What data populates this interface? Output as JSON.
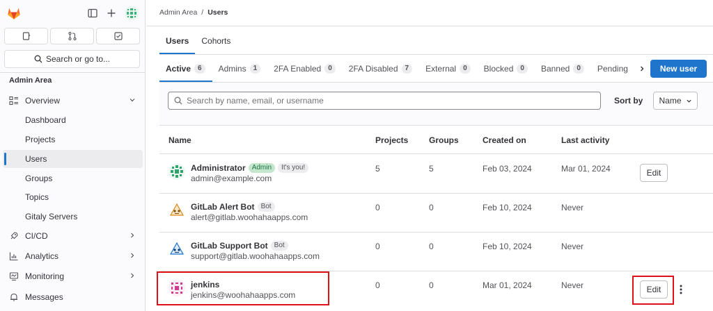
{
  "sidebar": {
    "search_label": "Search or go to...",
    "section_title": "Admin Area",
    "items": [
      {
        "label": "Overview",
        "icon": "overview-icon",
        "expandable": true,
        "expanded": true
      },
      {
        "label": "Dashboard"
      },
      {
        "label": "Projects"
      },
      {
        "label": "Users",
        "active": true
      },
      {
        "label": "Groups"
      },
      {
        "label": "Topics"
      },
      {
        "label": "Gitaly Servers"
      },
      {
        "label": "CI/CD",
        "icon": "rocket-icon",
        "expandable": true
      },
      {
        "label": "Analytics",
        "icon": "chart-icon",
        "expandable": true
      },
      {
        "label": "Monitoring",
        "icon": "monitor-icon",
        "expandable": true
      },
      {
        "label": "Messages",
        "icon": "bell-icon"
      }
    ]
  },
  "breadcrumb": {
    "parent": "Admin Area",
    "separator": "/",
    "current": "Users"
  },
  "tabs": [
    {
      "label": "Users",
      "active": true
    },
    {
      "label": "Cohorts"
    }
  ],
  "filter_tabs": [
    {
      "label": "Active",
      "count": "6",
      "active": true
    },
    {
      "label": "Admins",
      "count": "1"
    },
    {
      "label": "2FA Enabled",
      "count": "0"
    },
    {
      "label": "2FA Disabled",
      "count": "7"
    },
    {
      "label": "External",
      "count": "0"
    },
    {
      "label": "Blocked",
      "count": "0"
    },
    {
      "label": "Banned",
      "count": "0"
    },
    {
      "label": "Pending",
      "count": ""
    }
  ],
  "new_user_label": "New user",
  "search": {
    "placeholder": "Search by name, email, or username",
    "value": ""
  },
  "sort": {
    "label": "Sort by",
    "value": "Name"
  },
  "table": {
    "columns": [
      "Name",
      "Projects",
      "Groups",
      "Created on",
      "Last activity"
    ],
    "rows": [
      {
        "name": "Administrator",
        "badges": [
          "Admin",
          "It's you!"
        ],
        "email": "admin@example.com",
        "projects": "5",
        "groups": "5",
        "created": "Feb 03, 2024",
        "last_activity": "Mar 01, 2024",
        "edit": "Edit"
      },
      {
        "name": "GitLab Alert Bot",
        "badges": [
          "Bot"
        ],
        "email": "alert@gitlab.woohahaapps.com",
        "projects": "0",
        "groups": "0",
        "created": "Feb 10, 2024",
        "last_activity": "Never",
        "edit": ""
      },
      {
        "name": "GitLab Support Bot",
        "badges": [
          "Bot"
        ],
        "email": "support@gitlab.woohahaapps.com",
        "projects": "0",
        "groups": "0",
        "created": "Feb 10, 2024",
        "last_activity": "Never",
        "edit": ""
      },
      {
        "name": "jenkins",
        "badges": [],
        "email": "jenkins@woohahaapps.com",
        "projects": "0",
        "groups": "0",
        "created": "Mar 01, 2024",
        "last_activity": "Never",
        "edit": "Edit"
      }
    ]
  },
  "colors": {
    "accent": "#1f75cb",
    "highlight": "#e0101a",
    "admin_badge": "#c3e6cd"
  }
}
